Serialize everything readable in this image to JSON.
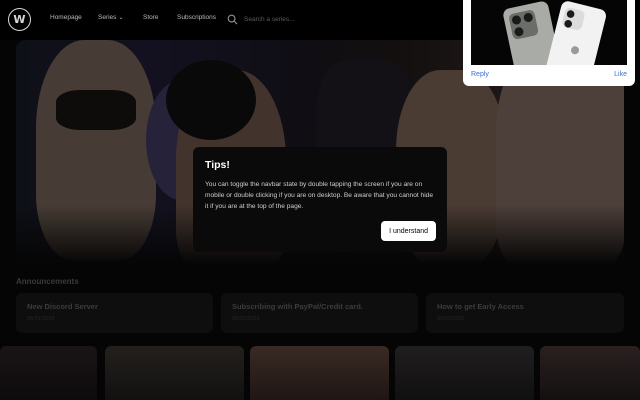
{
  "nav": {
    "logo": "W",
    "links": [
      "Homepage",
      "Series",
      "Store",
      "Subscriptions"
    ],
    "series_chevron": "⌄",
    "search_placeholder": "Search a series..."
  },
  "modal": {
    "title": "Tips!",
    "body": "You can toggle the navbar state by double tapping the screen if you are on mobile or double clicking if you are on desktop. Be aware that you cannot hide it if you are at the top of the page.",
    "button": "I understand"
  },
  "announcements": {
    "heading": "Announcements",
    "items": [
      {
        "title": "New Discord Server",
        "date": "05/01/2025"
      },
      {
        "title": "Subscribing with PayPal/Credit card.",
        "date": "05/01/2025"
      },
      {
        "title": "How to get Early Access",
        "date": "05/01/2025"
      }
    ]
  },
  "ad": {
    "reply": "Reply",
    "like": "Like"
  },
  "colors": {
    "background": "#050505",
    "link_blue": "#3b6fd1",
    "button_bg": "#ffffff"
  }
}
